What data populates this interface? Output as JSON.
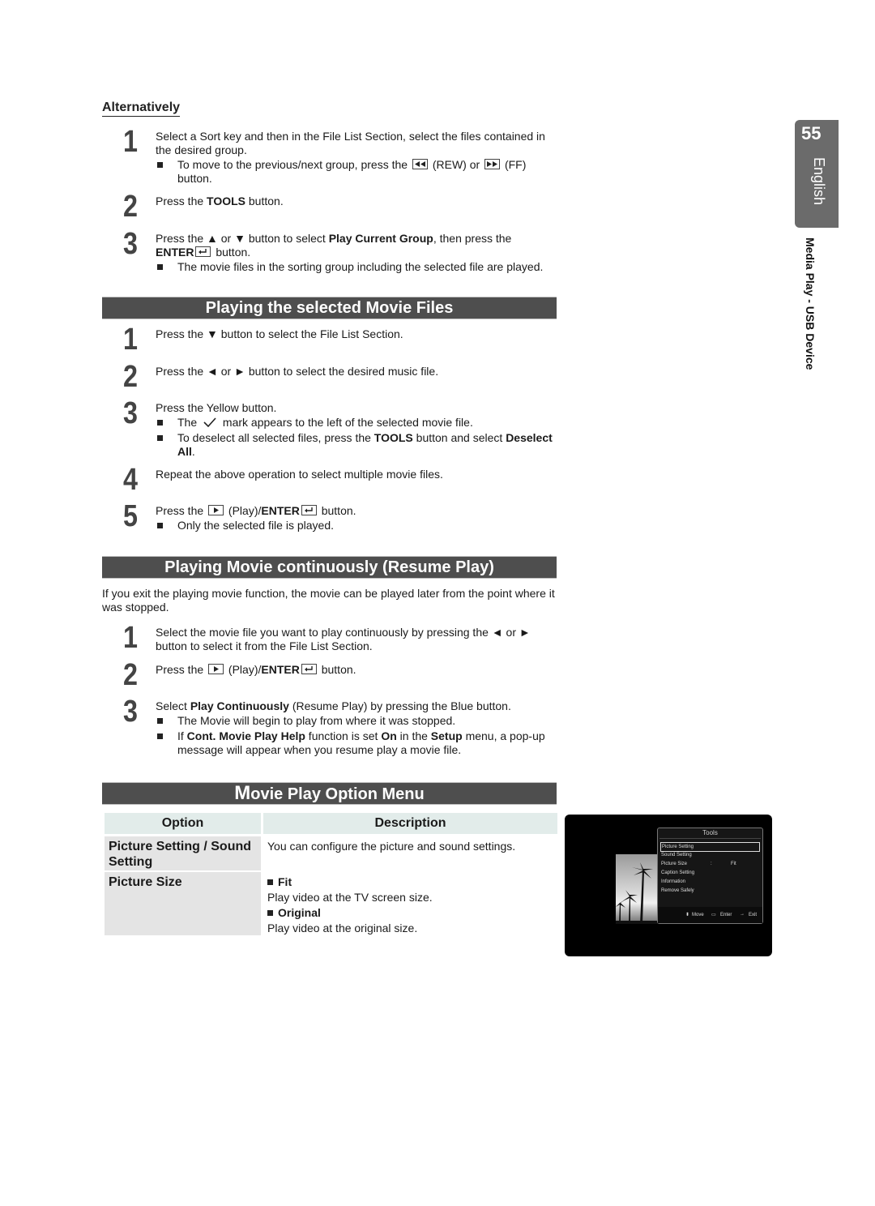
{
  "side_tab": {
    "page_number": "55",
    "language": "English",
    "chapter": "Media Play - USB Device"
  },
  "alternatively": {
    "heading": "Alternatively",
    "steps": [
      {
        "num": "1",
        "text": "Select a Sort key and then in the File List Section, select the files contained in the desired group.",
        "bullet_pre": "To move to the previous/next group, press the",
        "rew_label": "(REW) or",
        "ff_label": "(FF) button.",
        "rew_icon": "rewind-icon",
        "ff_icon": "fast-forward-icon"
      },
      {
        "num": "2",
        "pre": "Press the ",
        "bold": "TOOLS",
        "post": " button."
      },
      {
        "num": "3",
        "pre": "Press the ▲ or ▼ button to select ",
        "bold": "Play Current Group",
        "mid": ", then press the",
        "enter": "ENTER",
        "post": " button.",
        "bullet": "The movie files in the sorting group including the selected file are played."
      }
    ]
  },
  "section1": {
    "title": "Playing the selected Movie Files",
    "steps": [
      {
        "num": "1",
        "text": "Press the ▼ button to select the File List Section."
      },
      {
        "num": "2",
        "text": "Press the ◄ or ► button to select the desired music file."
      },
      {
        "num": "3",
        "text": "Press the Yellow button.",
        "bullet1_pre": "The",
        "bullet1_post": "mark appears to the left of the selected movie file.",
        "bullet2_pre": "To deselect all selected files, press the ",
        "bullet2_bold1": "TOOLS",
        "bullet2_mid": " button and select ",
        "bullet2_bold2": "Deselect All",
        "bullet2_post": "."
      },
      {
        "num": "4",
        "text": "Repeat the above operation to select multiple movie files."
      },
      {
        "num": "5",
        "pre": "Press the",
        "play": "(Play)/",
        "enter": "ENTER",
        "post": " button.",
        "bullet": "Only the selected file is played."
      }
    ]
  },
  "section2": {
    "title": "Playing Movie continuously (Resume Play)",
    "intro": "If you exit the playing movie function, the movie can be played later from the point where it was stopped.",
    "steps": [
      {
        "num": "1",
        "text": "Select the movie file you want to play continuously by pressing the ◄ or ► button to select it from the File List Section."
      },
      {
        "num": "2",
        "pre": "Press the",
        "play": "(Play)/",
        "enter": "ENTER",
        "post": " button."
      },
      {
        "num": "3",
        "pre": "Select ",
        "bold": "Play Continuously",
        "post": " (Resume Play) by pressing the Blue button.",
        "bullet1": "The Movie will begin to play from where it was stopped.",
        "b2_a": "If ",
        "b2_b": "Cont. Movie Play Help",
        "b2_c": " function is set ",
        "b2_d": "On",
        "b2_e": " in the ",
        "b2_f": "Setup",
        "b2_g": " menu, a pop-up message will appear when you resume play a movie file."
      }
    ]
  },
  "section3": {
    "title_first": "M",
    "title_rest": "ovie Play Option Menu",
    "table": {
      "headers": [
        "Option",
        "Description"
      ],
      "rows": [
        {
          "option": "Picture Setting / Sound Setting",
          "description": "You can configure the picture and sound settings."
        },
        {
          "option": "Picture Size",
          "fit_label": "Fit",
          "fit_desc": "Play video at the TV screen size.",
          "orig_label": "Original",
          "orig_desc": "Play video at the original size."
        }
      ]
    }
  },
  "tv_screen": {
    "tools_title": "Tools",
    "items": [
      "Picture Setting",
      "Sound Setting",
      "Picture Size",
      "Caption Setting",
      "Information",
      "Remove Safely"
    ],
    "picture_size_sep": ":",
    "picture_size_value": "Fit",
    "selected_index": 0,
    "footer": {
      "move": "Move",
      "enter": "Enter",
      "exit": "Exit"
    }
  }
}
